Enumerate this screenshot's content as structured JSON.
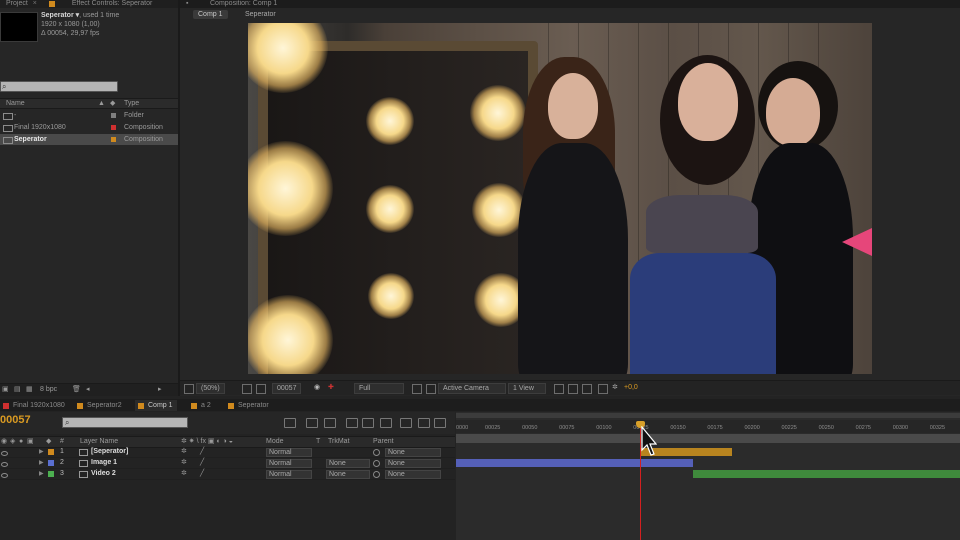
{
  "project": {
    "tab_project": "Project",
    "tab_effect_controls": "Effect Controls: Seperator",
    "item_name": "Seperator",
    "item_used": ", used 1 time",
    "item_size": "1920 x 1080 (1,00)",
    "item_duration": "Δ 00054, 29,97 fps",
    "col_name": "Name",
    "col_type": "Type",
    "items": [
      {
        "name": "-",
        "type": "Folder",
        "label_color": "#7f7f7f",
        "selected": false
      },
      {
        "name": "Final 1920x1080",
        "type": "Composition",
        "label_color": "#cf3030",
        "selected": false
      },
      {
        "name": "Seperator",
        "type": "Composition",
        "label_color": "#d08a1e",
        "selected": true
      }
    ],
    "bpc": "8 bpc"
  },
  "viewer": {
    "tab_title": "Composition: Comp 1",
    "breadcrumbs": [
      "Comp 1",
      "Seperator"
    ],
    "zoom": "(50%)",
    "timecode": "00057",
    "resolution": "Full",
    "camera": "Active Camera",
    "views": "1 View",
    "exposure": "+0,0"
  },
  "timeline": {
    "tabs": [
      {
        "label": "Final 1920x1080",
        "color": "#cf3030",
        "active": false
      },
      {
        "label": "Seperator2",
        "color": "#d08a1e",
        "active": false
      },
      {
        "label": "Comp 1",
        "color": "#d08a1e",
        "active": true
      },
      {
        "label": "a 2",
        "color": "#d08a1e",
        "active": false
      },
      {
        "label": "Seperator",
        "color": "#d08a1e",
        "active": false
      }
    ],
    "current_time": "00057",
    "columns": {
      "layer_name": "Layer Name",
      "mode": "Mode",
      "t": "T",
      "trkmat": "TrkMat",
      "parent": "Parent"
    },
    "layers": [
      {
        "index": "1",
        "name": "[Seperator]",
        "mode": "Normal",
        "trkmat": "",
        "parent": "None",
        "label_color": "#d08a1e"
      },
      {
        "index": "2",
        "name": "Image 1",
        "mode": "Normal",
        "trkmat": "None",
        "parent": "None",
        "label_color": "#5a6fd0"
      },
      {
        "index": "3",
        "name": "Video 2",
        "mode": "Normal",
        "trkmat": "None",
        "parent": "None",
        "label_color": "#4caf50"
      }
    ],
    "ruler_ticks": [
      "0000",
      "00025",
      "00050",
      "00075",
      "00100",
      "00125",
      "00150",
      "00175",
      "00200",
      "00225",
      "00250",
      "00275",
      "00300",
      "00325"
    ],
    "ruler_start": 0,
    "ruler_end": 340,
    "playhead_frame": 124,
    "layer_bars": [
      {
        "start": 124,
        "end": 186,
        "color": "#b8841f"
      },
      {
        "start": 0,
        "end": 160,
        "color": "#5560b8"
      },
      {
        "start": 160,
        "end": 340,
        "color": "#3f8a3c"
      }
    ]
  }
}
